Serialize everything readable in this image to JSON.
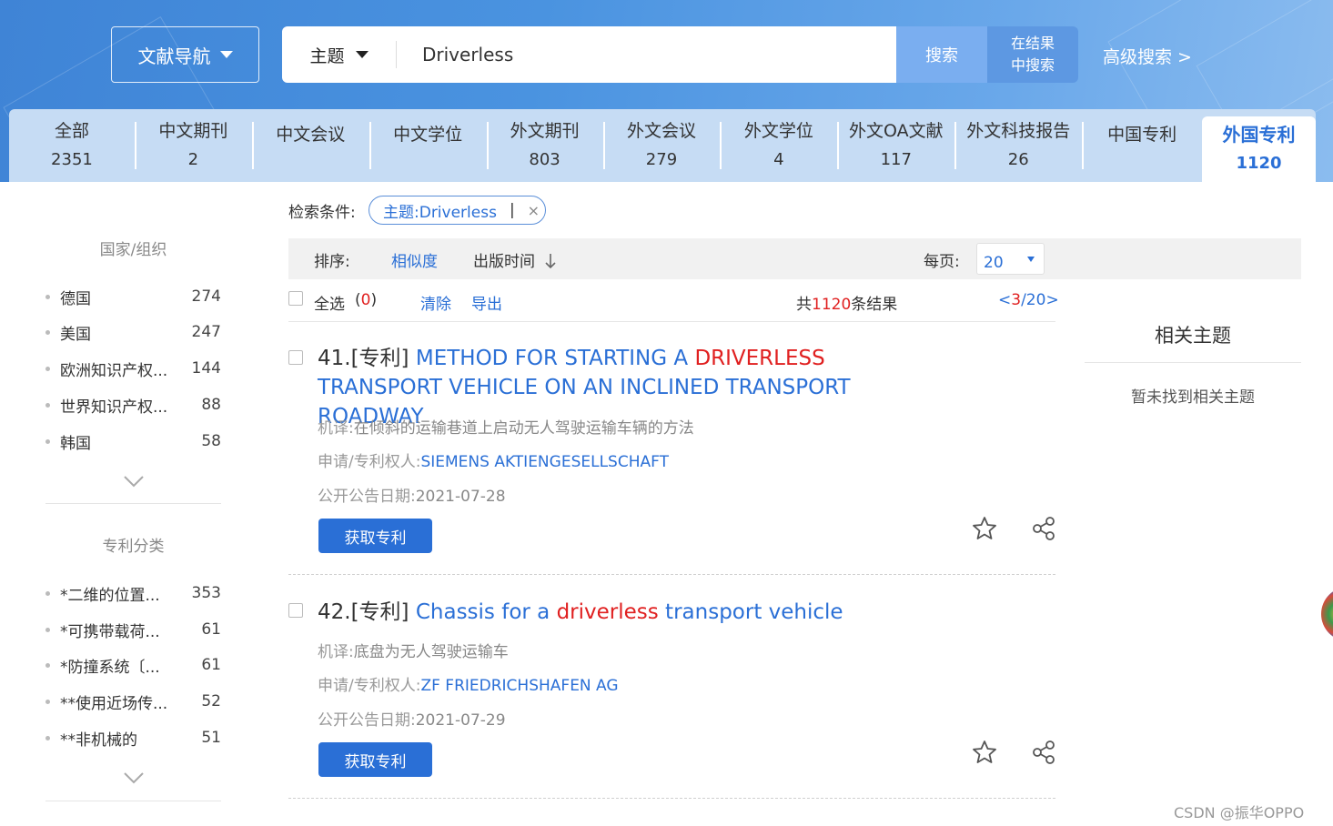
{
  "header": {
    "nav_label": "文献导航",
    "search_type": "主题",
    "search_value": "Driverless",
    "search_button": "搜索",
    "in_result_line1": "在结果",
    "in_result_line2": "中搜索",
    "advanced": "高级搜索 >"
  },
  "tabs": [
    {
      "label": "全部",
      "count": "2351"
    },
    {
      "label": "中文期刊",
      "count": "2"
    },
    {
      "label": "中文会议",
      "count": ""
    },
    {
      "label": "中文学位",
      "count": ""
    },
    {
      "label": "外文期刊",
      "count": "803"
    },
    {
      "label": "外文会议",
      "count": "279"
    },
    {
      "label": "外文学位",
      "count": "4"
    },
    {
      "label": "外文OA文献",
      "count": "117"
    },
    {
      "label": "外文科技报告",
      "count": "26"
    },
    {
      "label": "中国专利",
      "count": ""
    },
    {
      "label": "外国专利",
      "count": "1120"
    }
  ],
  "sidebar": {
    "country_title": "国家/组织",
    "countries": [
      {
        "name": "德国",
        "count": "274"
      },
      {
        "name": "美国",
        "count": "247"
      },
      {
        "name": "欧洲知识产权...",
        "count": "144"
      },
      {
        "name": "世界知识产权...",
        "count": "88"
      },
      {
        "name": "韩国",
        "count": "58"
      }
    ],
    "class_title": "专利分类",
    "classes": [
      {
        "name": "*二维的位置...",
        "count": "353"
      },
      {
        "name": "*可携带载荷...",
        "count": "61"
      },
      {
        "name": "*防撞系统〔...",
        "count": "61"
      },
      {
        "name": "**使用近场传...",
        "count": "52"
      },
      {
        "name": "**非机械的",
        "count": "51"
      }
    ]
  },
  "conditions": {
    "label": "检索条件:",
    "tag": "主题:Driverless",
    "tag_bar": "|",
    "tag_close": "×"
  },
  "sort": {
    "label": "排序:",
    "relevance": "相似度",
    "pubtime": "出版时间",
    "per_page_label": "每页:",
    "per_page": "20"
  },
  "toolbar": {
    "select_all": "全选",
    "selected_open": "(",
    "selected_count": "0",
    "selected_close": ")",
    "clear": "清除",
    "export": "导出",
    "total_prefix": "共",
    "total": "1120",
    "total_suffix": "条结果",
    "page_prev": "<",
    "page_current": "3",
    "page_rest": "/20>"
  },
  "results": [
    {
      "index": "41.[专利]",
      "title_part1": "METHOD FOR STARTING A ",
      "title_highlight": "DRIVERLESS",
      "title_part2": " TRANSPORT VEHICLE ON AN INCLINED TRANSPORT ROADWAY",
      "translation_label": "机译:",
      "translation": "在倾斜的运输巷道上启动无人驾驶运输车辆的方法",
      "applicant_label": "申请/专利权人:",
      "applicant": "SIEMENS AKTIENGESELLSCHAFT",
      "date_label": "公开公告日期:",
      "date": "2021-07-28",
      "button": "获取专利"
    },
    {
      "index": "42.[专利]",
      "title_part1": "Chassis for a ",
      "title_highlight": "driverless",
      "title_part2": " transport vehicle",
      "translation_label": "机译:",
      "translation": "底盘为无人驾驶运输车",
      "applicant_label": "申请/专利权人:",
      "applicant": "ZF FRIEDRICHSHAFEN AG",
      "date_label": "公开公告日期:",
      "date": "2021-07-29",
      "button": "获取专利"
    }
  ],
  "related": {
    "title": "相关主题",
    "empty": "暂未找到相关主题"
  },
  "watermark": "CSDN @振华OPPO",
  "colors": {
    "accent": "#2a6fd6",
    "highlight": "#e02020",
    "tab_bg": "#c6dcf4"
  }
}
